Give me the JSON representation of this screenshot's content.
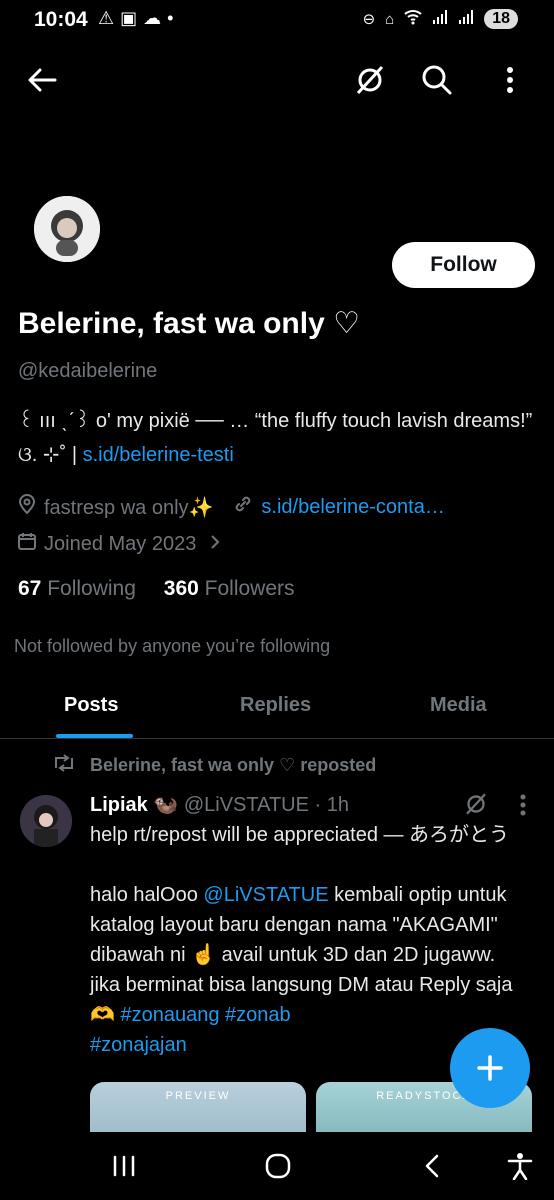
{
  "status": {
    "time": "10:04",
    "left_icons": [
      "warning-icon",
      "screen-record-icon",
      "weather-icon",
      "dot-icon"
    ],
    "right_icons": [
      "dnd-icon",
      "sleep-icon",
      "wifi-icon",
      "signal-icon",
      "signal-icon"
    ],
    "battery": "18"
  },
  "header": {
    "icons": [
      "back-arrow-icon",
      "grok-icon",
      "search-icon",
      "more-vertical-icon"
    ]
  },
  "profile": {
    "follow_label": "Follow",
    "display_name": "Belerine, fast wa only ♡",
    "handle": "@kedaibelerine",
    "bio_text": "꒰ ııı ˎˊ꒱ o' my pixië ── … “the fluffy touch lavish dreams!” ଓ. ⊹˚ | ",
    "bio_link": "s.id/belerine-testi",
    "location": "fastresp wa only✨",
    "website": "s.id/belerine-conta…",
    "joined": "Joined May 2023",
    "following_count": "67",
    "following_label": "Following",
    "followers_count": "360",
    "followers_label": "Followers",
    "not_followed": "Not followed by anyone you’re following"
  },
  "tabs": [
    {
      "label": "Posts",
      "active": true
    },
    {
      "label": "Replies",
      "active": false
    },
    {
      "label": "Media",
      "active": false
    }
  ],
  "post": {
    "repost_text": "Belerine, fast wa only ♡ reposted",
    "author_name": "Lipiak 🦦",
    "author_handle": "@LiVSTATUE",
    "time": "· 1h",
    "line1": "help rt/repost will be appreciated ― あろがとう",
    "body_pre": "halo halOoo ",
    "mention": "@LiVSTATUE",
    "body_mid": " kembali optip untuk katalog layout baru dengan nama \"AKAGAMI\" dibawah ni ☝️ avail untuk 3D dan 2D jugaww. jika berminat bisa langsung DM atau Reply saja 🫶 ",
    "hashtag1": "#zonauang",
    "hashtag2": "#zonab",
    "hashtag3": "#zonajajan",
    "media_labels": [
      "PREVIEW",
      "READYSTOCK"
    ]
  },
  "colors": {
    "accent": "#1d9bf0",
    "background": "#000000",
    "secondary_text": "#71767b"
  },
  "navbar": {
    "icons": [
      "recent-apps-icon",
      "home-icon",
      "back-icon",
      "accessibility-icon"
    ]
  }
}
